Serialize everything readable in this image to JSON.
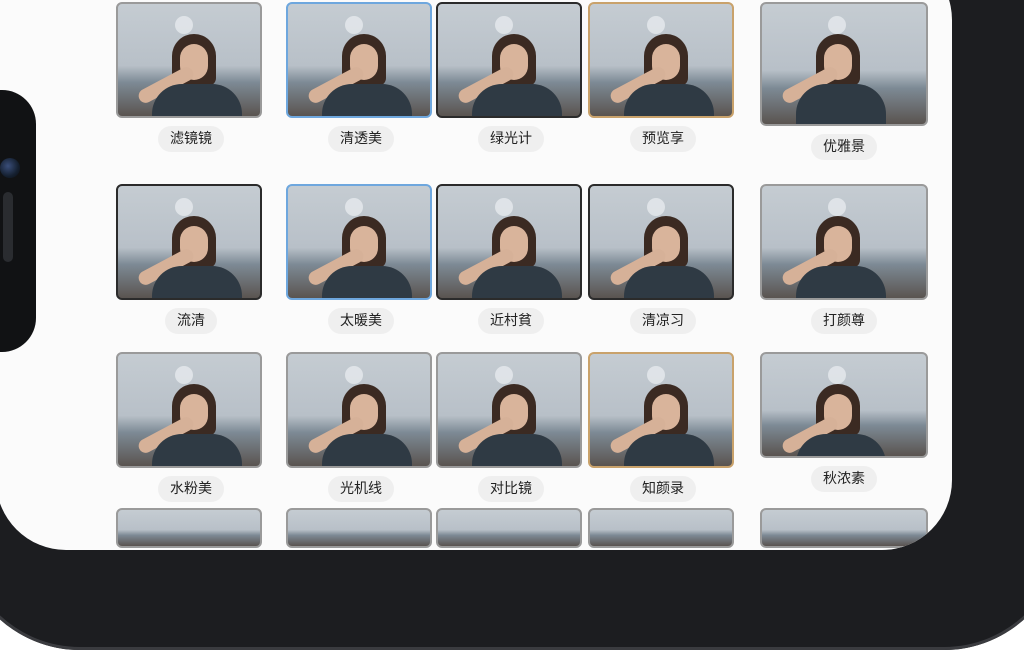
{
  "status_bar": {
    "tabs": [
      "",
      "",
      ""
    ],
    "icons": "☰ ▮▮▮"
  },
  "grid": {
    "rows": [
      [
        "滤镜镜",
        "清透美",
        "绿光计",
        "预览享",
        "优雅景"
      ],
      [
        "流清",
        "太暖美",
        "近村貧",
        "清凉习",
        "打颜尊"
      ],
      [
        "水粉美",
        "光机线",
        "对比镜",
        "知颜录",
        "秋浓素"
      ]
    ]
  }
}
